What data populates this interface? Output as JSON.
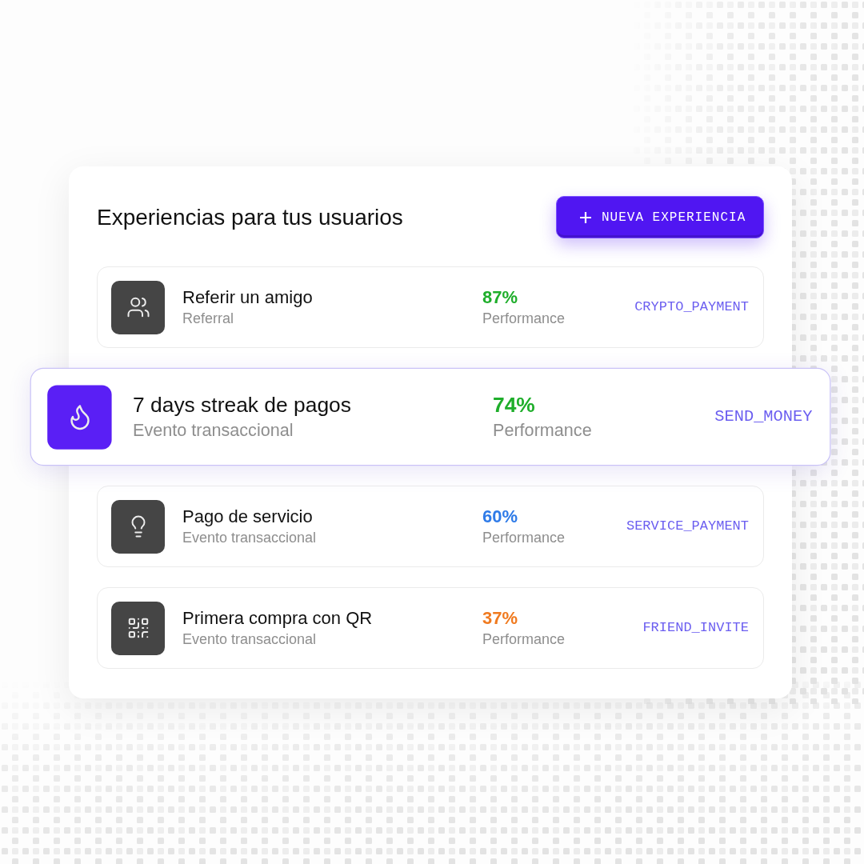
{
  "header": {
    "title": "Experiencias para tus usuarios",
    "new_button": {
      "label": "NUEVA EXPERIENCIA"
    }
  },
  "experiences": [
    {
      "title": "Referir un amigo",
      "subtitle": "Referral",
      "performance": "87%",
      "color": "#1fae2b",
      "performance_label": "Performance",
      "event": "CRYPTO_PAYMENT",
      "selected": false
    },
    {
      "title": "7 days streak de pagos",
      "subtitle": "Evento transaccional",
      "performance": "74%",
      "color": "#1fae2b",
      "performance_label": "Performance",
      "event": "SEND_MONEY",
      "selected": true
    },
    {
      "title": "Pago de servicio",
      "subtitle": "Evento transaccional",
      "performance": "60%",
      "color": "#2f7be8",
      "performance_label": "Performance",
      "event": "SERVICE_PAYMENT",
      "selected": false
    },
    {
      "title": "Primera compra con QR",
      "subtitle": "Evento transaccional",
      "performance": "37%",
      "color": "#f07a1f",
      "performance_label": "Performance",
      "event": "FRIEND_INVITE",
      "selected": false
    }
  ]
}
